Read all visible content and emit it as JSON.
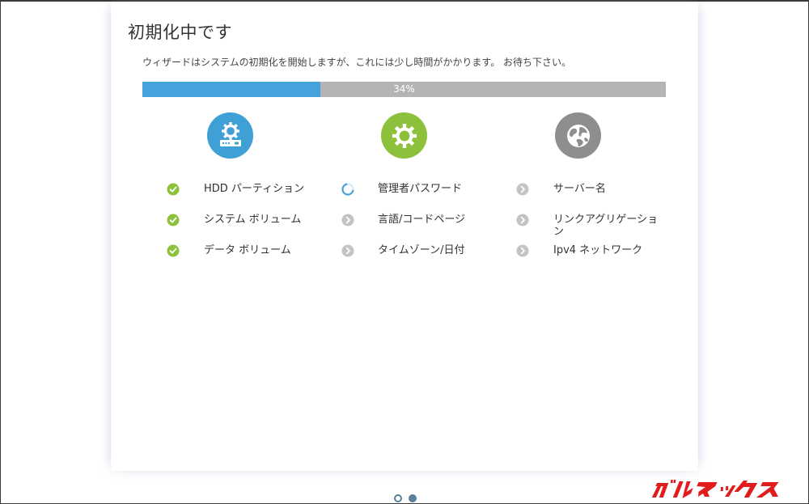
{
  "window": {
    "title": "初期化中です",
    "subtitle": "ウィザードはシステムの初期化を開始しますが、これには少し時間がかかります。 お待ち下さい。"
  },
  "progress": {
    "percent": 34,
    "label": "34%",
    "fill_color": "#45a2da",
    "track_color": "#b4b4b4"
  },
  "columns": [
    {
      "icon": "storage-gear-icon",
      "icon_color": "#3fa0d6",
      "tasks": [
        {
          "label": "HDD パーティション",
          "status": "done"
        },
        {
          "label": "システム ボリューム",
          "status": "done"
        },
        {
          "label": "データ ボリューム",
          "status": "done"
        }
      ]
    },
    {
      "icon": "gear-icon",
      "icon_color": "#8dc13c",
      "tasks": [
        {
          "label": "管理者パスワード",
          "status": "in-progress"
        },
        {
          "label": "言語/コードページ",
          "status": "pending"
        },
        {
          "label": "タイムゾーン/日付",
          "status": "pending"
        }
      ]
    },
    {
      "icon": "globe-icon",
      "icon_color": "#8e8e8e",
      "tasks": [
        {
          "label": "サーバー名",
          "status": "pending"
        },
        {
          "label": "リンクアグリゲーション",
          "status": "pending"
        },
        {
          "label": "Ipv4 ネットワーク",
          "status": "pending"
        }
      ]
    }
  ],
  "pager": {
    "current_page": 1,
    "total_pages": 2
  },
  "watermark": {
    "text": "ガルマックス",
    "color": "#e01c1c"
  },
  "colors": {
    "done": "#8dc13c",
    "pending": "#c4c4c4",
    "spinner": "#45a2da"
  }
}
